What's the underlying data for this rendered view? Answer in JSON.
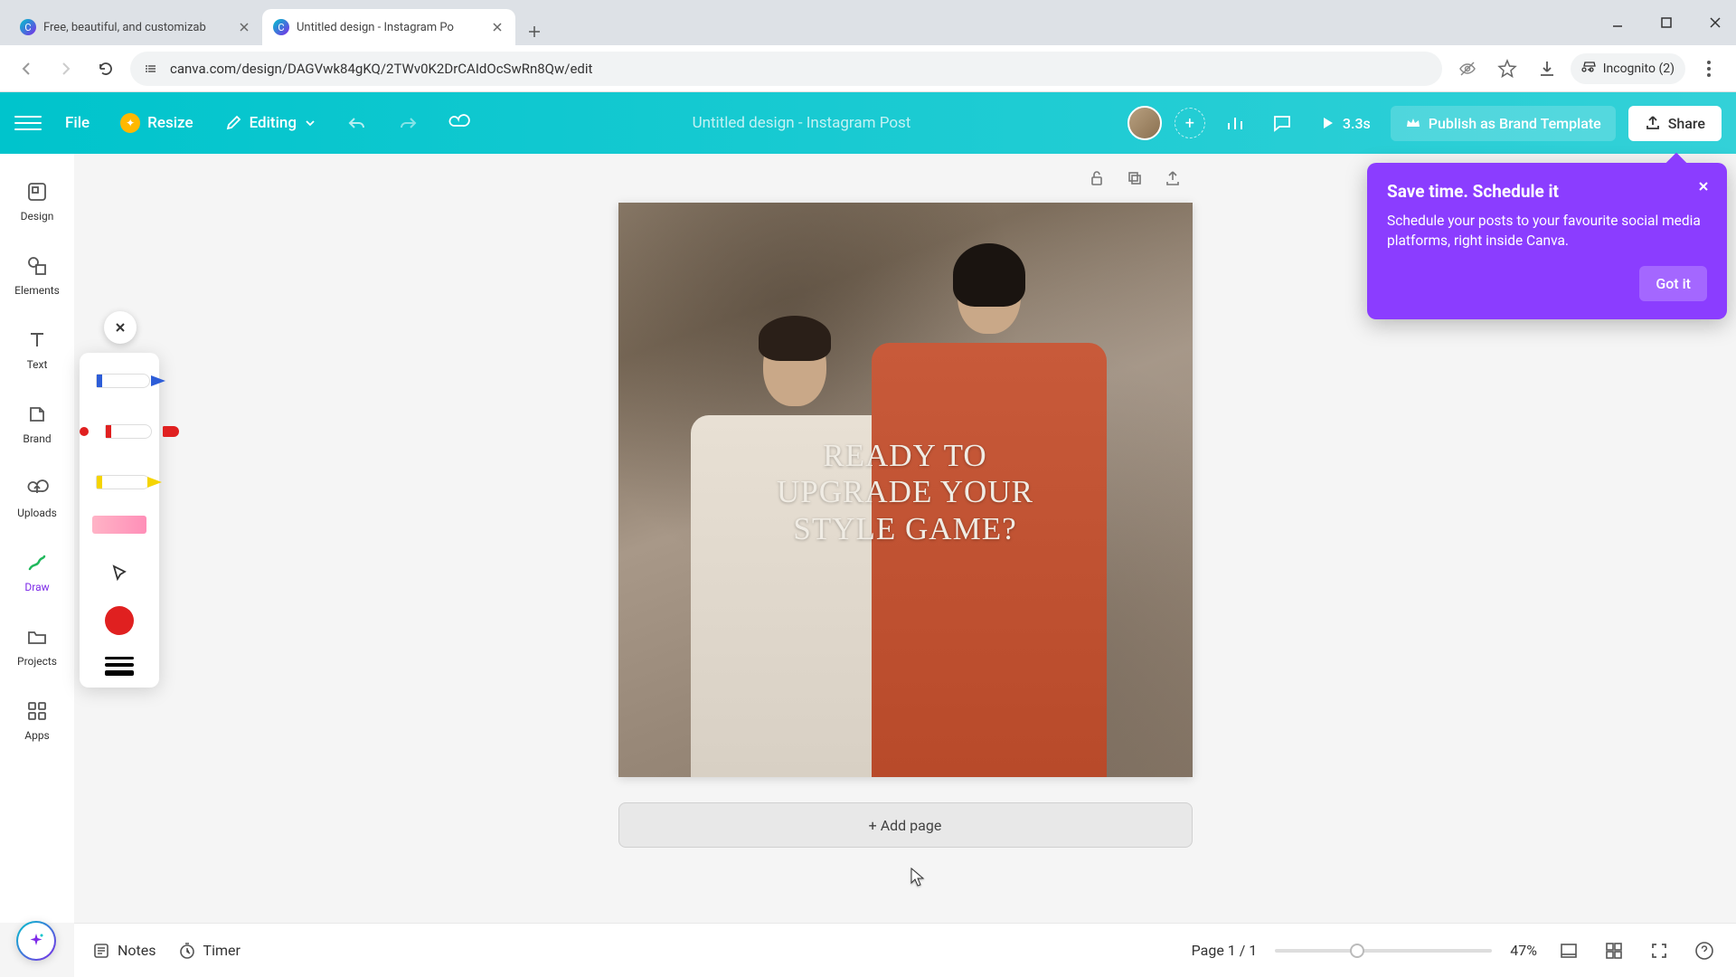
{
  "browser": {
    "tabs": [
      {
        "title": "Free, beautiful, and customizab",
        "favicon": "canva"
      },
      {
        "title": "Untitled design - Instagram Po",
        "favicon": "canva"
      }
    ],
    "url": "canva.com/design/DAGVwk84gKQ/2TWv0K2DrCAIdOcSwRn8Qw/edit",
    "incognito_label": "Incognito (2)"
  },
  "appbar": {
    "file": "File",
    "resize": "Resize",
    "editing": "Editing",
    "doc_title": "Untitled design - Instagram Post",
    "duration": "3.3s",
    "publish": "Publish as Brand Template",
    "share": "Share"
  },
  "rail": {
    "design": "Design",
    "elements": "Elements",
    "text": "Text",
    "brand": "Brand",
    "uploads": "Uploads",
    "draw": "Draw",
    "projects": "Projects",
    "apps": "Apps"
  },
  "canvas": {
    "headline": "READY TO\nUPGRADE YOUR\nSTYLE GAME?",
    "add_page": "+ Add page"
  },
  "promo": {
    "title": "Save time. Schedule it",
    "body": "Schedule your posts to your favourite social media platforms, right inside Canva.",
    "cta": "Got it"
  },
  "bottom": {
    "notes": "Notes",
    "timer": "Timer",
    "page_indicator": "Page 1 / 1",
    "zoom": "47%"
  }
}
